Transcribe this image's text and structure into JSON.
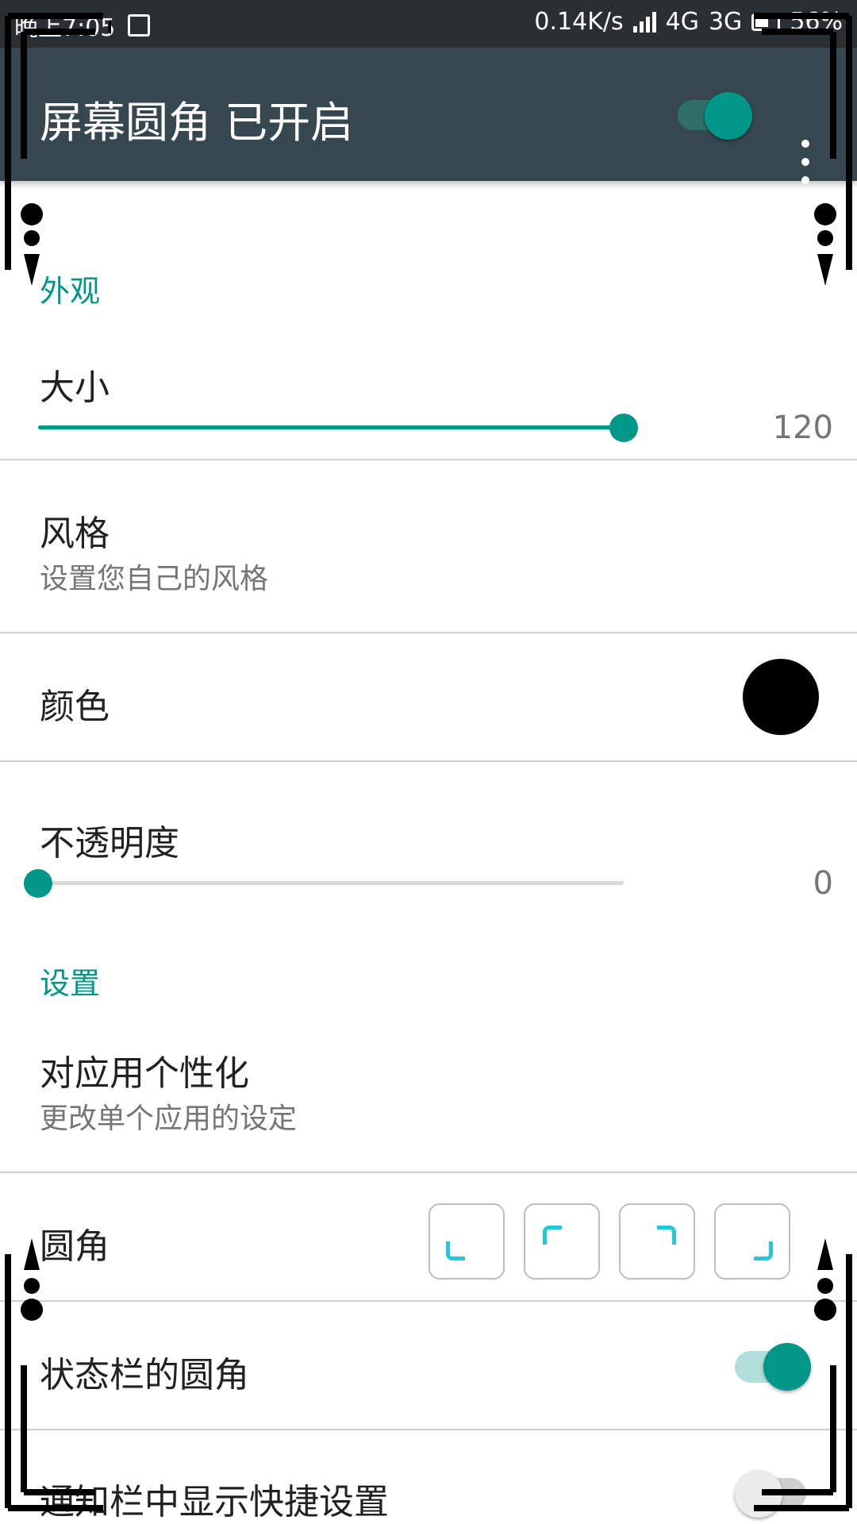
{
  "status_bar": {
    "time": "晚上7:05",
    "net_speed": "0.14K/s",
    "network_a": "4G",
    "network_b": "3G",
    "battery": "56%"
  },
  "app_bar": {
    "title": "屏幕圆角 已开启",
    "enabled": true
  },
  "sections": {
    "appearance": "外观",
    "settings": "设置"
  },
  "size": {
    "label": "大小",
    "value": "120",
    "fraction": 1.0
  },
  "style": {
    "label": "风格",
    "sub": "设置您自己的风格"
  },
  "color": {
    "label": "颜色",
    "swatch": "#000000"
  },
  "opacity": {
    "label": "不透明度",
    "value": "0",
    "fraction": 0.0
  },
  "per_app": {
    "label": "对应用个性化",
    "sub": "更改单个应用的设定"
  },
  "corners": {
    "label": "圆角",
    "items": [
      "bottom-left",
      "top-left",
      "top-right",
      "bottom-right"
    ]
  },
  "statusbar_corners": {
    "label": "状态栏的圆角",
    "enabled": true
  },
  "quick_settings": {
    "label": "通知栏中显示快捷设置",
    "enabled": false
  },
  "colors": {
    "accent": "#009688",
    "appbar": "#37474f",
    "corner_icon": "#26c6da"
  }
}
